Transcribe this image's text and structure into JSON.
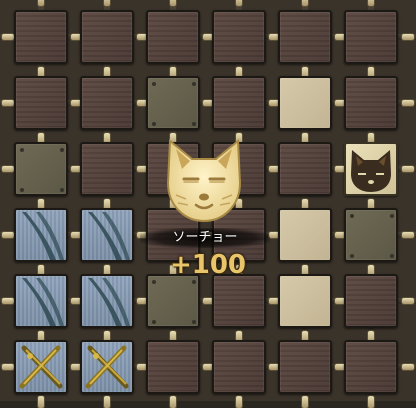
{
  "popup": {
    "icon": "fox-face-icon",
    "name": "ソーチョー",
    "points": "+100"
  },
  "colors": {
    "wood": "#544239",
    "olive": "#66624e",
    "beige": "#cdbf9e",
    "blue": "#8497b0",
    "cream": "#e2d6ab",
    "score": "#e8c46a"
  },
  "grid": {
    "columns": 6,
    "rows": 6,
    "tiles": [
      [
        "wood",
        "wood",
        "wood",
        "wood",
        "wood",
        "wood"
      ],
      [
        "wood",
        "wood",
        "olive",
        "wood",
        "beige",
        "wood"
      ],
      [
        "olive",
        "wood",
        "wood",
        "wood",
        "wood",
        "cream-fox"
      ],
      [
        "blue-feather",
        "blue-feather",
        "wood",
        "wood",
        "beige",
        "olive"
      ],
      [
        "blue-feather",
        "blue-feather",
        "olive",
        "wood",
        "beige",
        "wood"
      ],
      [
        "blue-swords",
        "blue-swords",
        "wood",
        "wood",
        "wood",
        "wood"
      ]
    ]
  }
}
